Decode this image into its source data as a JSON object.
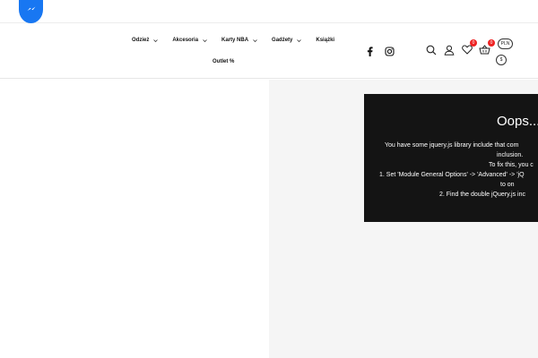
{
  "nav": {
    "items": [
      {
        "label": "Odzież",
        "dropdown": true
      },
      {
        "label": "Akcesoria",
        "dropdown": true
      },
      {
        "label": "Karty NBA",
        "dropdown": true
      },
      {
        "label": "Gadżety",
        "dropdown": true
      },
      {
        "label": "Książki",
        "dropdown": false
      }
    ],
    "outlet": "Outlet %"
  },
  "social": [
    "facebook-icon",
    "instagram-icon"
  ],
  "tools": {
    "wishlist_count": "0",
    "cart_count": "0"
  },
  "currency": {
    "selected": "PLN",
    "symbol": "$"
  },
  "error": {
    "title": "Oops...",
    "line1": "You have some jquery.js library include that com",
    "line2": "inclusion.",
    "line3": "To fix this, you c",
    "line4": "1. Set 'Module General Options' -> 'Advanced' -> 'jQ",
    "line5": "to on",
    "line6": "2. Find the double jQuery.js inc"
  },
  "colors": {
    "messenger": "#1877f2",
    "badge": "#e22222",
    "error_bg": "#141414",
    "right_panel": "#f5f5f5"
  }
}
